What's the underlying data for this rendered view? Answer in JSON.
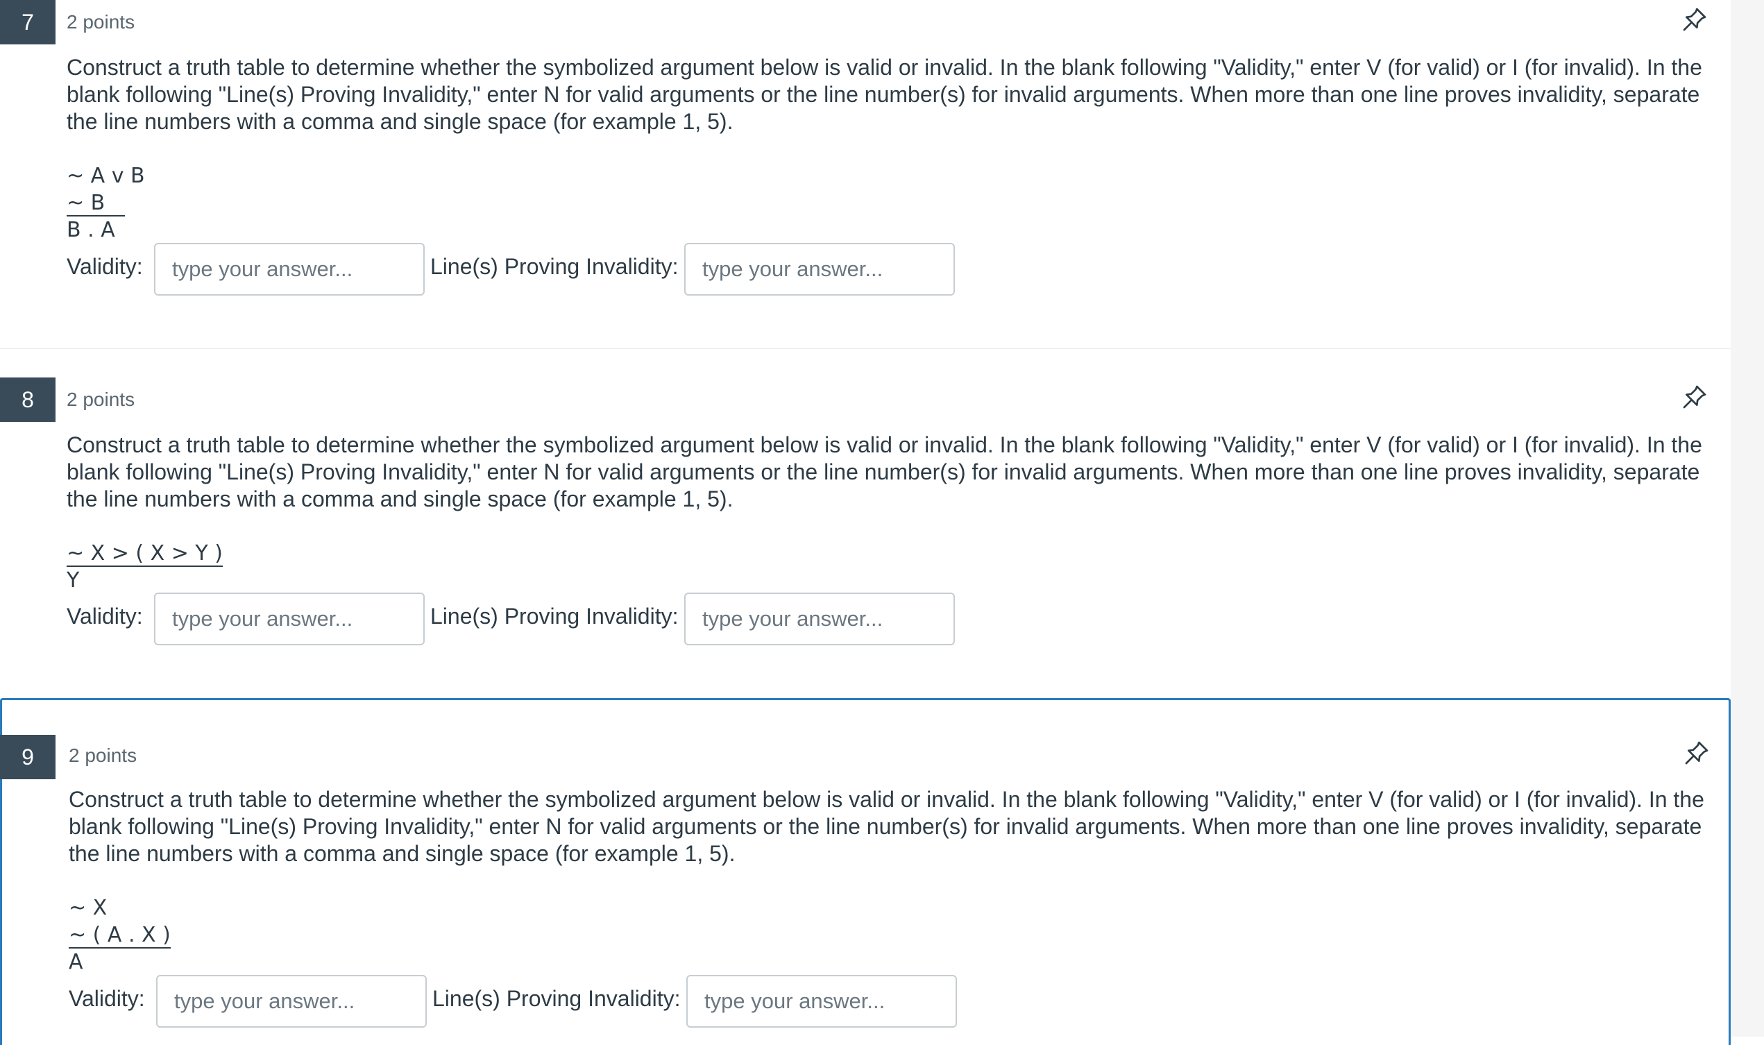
{
  "instructions": "Construct a truth table to determine whether the symbolized argument below is valid or invalid. In the blank following \"Validity,\" enter V (for valid) or I (for invalid). In the blank following \"Line(s) Proving Invalidity,\" enter N for valid arguments or the line number(s) for invalid arguments. When more than one line proves invalidity, separate the line numbers with a comma and single space (for example 1, 5).",
  "labels": {
    "validity": "Validity:",
    "lines": "Line(s) Proving Invalidity:",
    "placeholder": "type your answer..."
  },
  "questions": [
    {
      "number": "7",
      "points": "2 points",
      "premises": [
        "~ A v B"
      ],
      "last_premise": "~ B   ",
      "conclusion": "B . A"
    },
    {
      "number": "8",
      "points": "2 points",
      "premises": [],
      "last_premise": "~ X > ( X > Y )",
      "conclusion": "Y"
    },
    {
      "number": "9",
      "points": "2 points",
      "premises": [
        "~ X"
      ],
      "last_premise": "~ ( A . X )",
      "conclusion": "A"
    }
  ],
  "colors": {
    "number_badge": "#394b58",
    "text": "#2d3b45",
    "focus_border": "#2b7abc",
    "input_border": "#c7cdd1"
  },
  "icons": {
    "flag": "pin-icon"
  }
}
